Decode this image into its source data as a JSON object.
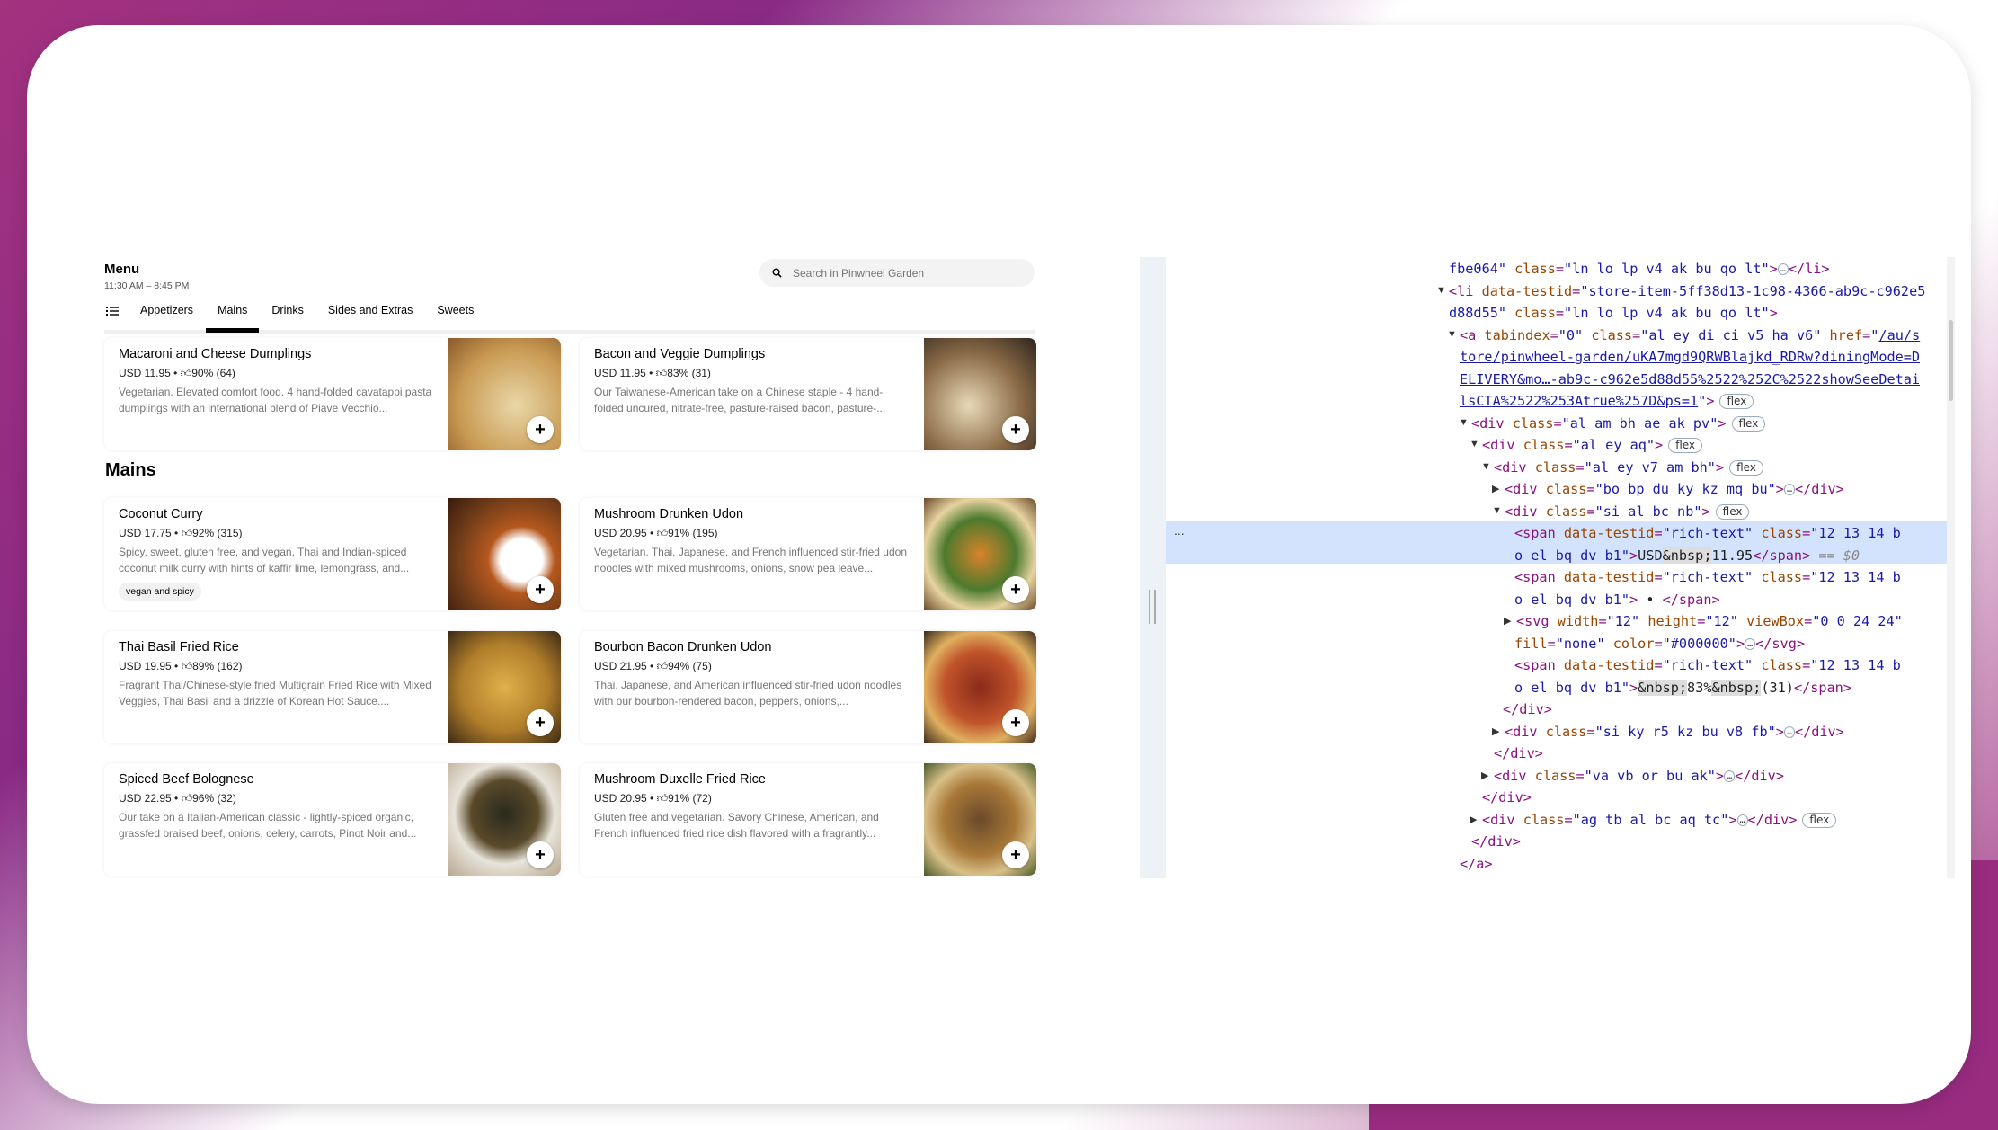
{
  "menu": {
    "title": "Menu",
    "hours": "11:30 AM – 8:45 PM",
    "search_placeholder": "Search in Pinwheel Garden",
    "tabs": [
      {
        "label": "Appetizers"
      },
      {
        "label": "Mains",
        "active": true
      },
      {
        "label": "Drinks"
      },
      {
        "label": "Sides and Extras"
      },
      {
        "label": "Sweets"
      }
    ],
    "section_heading": "Mains",
    "add_label": "+",
    "items": [
      {
        "title": "Macaroni and Cheese Dumplings",
        "price": "USD 11.95 • ",
        "rating": "90% (64)",
        "desc": "Vegetarian. Elevated comfort food. 4 hand-folded cavatappi pasta dumplings with an international blend of Piave Vecchio...",
        "tag": ""
      },
      {
        "title": "Bacon and Veggie Dumplings",
        "price": "USD 11.95 • ",
        "rating": "83% (31)",
        "desc": "Our Taiwanese-American take on a Chinese staple - 4 hand-folded uncured, nitrate-free, pasture-raised bacon, pasture-...",
        "tag": ""
      },
      {
        "title": "Coconut Curry",
        "price": "USD 17.75 • ",
        "rating": "92% (315)",
        "desc": "Spicy, sweet, gluten free, and vegan, Thai and Indian-spiced coconut milk curry with hints of kaffir lime, lemongrass, and...",
        "tag": "vegan and spicy"
      },
      {
        "title": "Mushroom Drunken Udon",
        "price": "USD 20.95 • ",
        "rating": "91% (195)",
        "desc": "Vegetarian. Thai, Japanese, and French influenced stir-fried udon noodles with mixed mushrooms, onions, snow pea leave...",
        "tag": ""
      },
      {
        "title": "Thai Basil Fried Rice",
        "price": "USD 19.95 • ",
        "rating": "89% (162)",
        "desc": "Fragrant Thai/Chinese-style fried Multigrain Fried Rice with Mixed Veggies, Thai Basil and a drizzle of Korean Hot Sauce....",
        "tag": ""
      },
      {
        "title": "Bourbon Bacon Drunken Udon",
        "price": "USD 21.95 • ",
        "rating": "94% (75)",
        "desc": "Thai, Japanese, and American influenced stir-fried udon noodles with our bourbon-rendered bacon, peppers, onions,...",
        "tag": ""
      },
      {
        "title": "Spiced Beef Bolognese",
        "price": "USD 22.95 • ",
        "rating": "96% (32)",
        "desc": "Our take on a Italian-American classic - lightly-spiced organic, grassfed braised beef, onions, celery, carrots, Pinot Noir and...",
        "tag": ""
      },
      {
        "title": "Mushroom Duxelle Fried Rice",
        "price": "USD 20.95 • ",
        "rating": "91% (72)",
        "desc": "Gluten free and vegetarian. Savory Chinese, American, and French influenced fried rice dish flavored with a fragrantly...",
        "tag": ""
      }
    ]
  },
  "devtools": {
    "selected_marker": "...",
    "lines": [
      {
        "arrow": "",
        "segs": [
          [
            "av",
            "fbe064\""
          ],
          [
            "an",
            " class"
          ],
          [
            "tg",
            "="
          ],
          [
            "av",
            "\"ln lo lp v4 ak bu qo lt\""
          ],
          [
            "tg",
            ">"
          ],
          [
            "ell",
            "…"
          ],
          [
            "tg",
            "</li>"
          ]
        ]
      },
      {
        "arrow": "▼",
        "segs": [
          [
            "tg",
            "<li"
          ],
          [
            "an",
            " data-testid"
          ],
          [
            "tg",
            "="
          ],
          [
            "av",
            "\"store-item-5ff38d13-1c98-4366-ab9c-c962e5"
          ]
        ]
      },
      {
        "arrow": "",
        "segs": [
          [
            "av",
            "d88d55\""
          ],
          [
            "an",
            " class"
          ],
          [
            "tg",
            "="
          ],
          [
            "av",
            "\"ln lo lp v4 ak bu qo lt\""
          ],
          [
            "tg",
            ">"
          ]
        ]
      },
      {
        "arrow": "▼",
        "segs": [
          [
            "tg",
            "<a"
          ],
          [
            "an",
            " tabindex"
          ],
          [
            "tg",
            "="
          ],
          [
            "av",
            "\"0\""
          ],
          [
            "an",
            " class"
          ],
          [
            "tg",
            "="
          ],
          [
            "av",
            "\"al ey di ci v5 ha v6\""
          ],
          [
            "an",
            " href"
          ],
          [
            "tg",
            "="
          ],
          [
            "av",
            "\""
          ],
          [
            "lk",
            "/au/s"
          ]
        ]
      },
      {
        "arrow": "",
        "segs": [
          [
            "lk",
            "tore/pinwheel-garden/uKA7mgd9QRWBlajkd_RDRw?diningMode=D"
          ]
        ]
      },
      {
        "arrow": "",
        "segs": [
          [
            "lk",
            "ELIVERY&mo…-ab9c-c962e5d88d55%2522%252C%2522showSeeDetai"
          ]
        ]
      },
      {
        "arrow": "",
        "segs": [
          [
            "lk",
            "lsCTA%2522%253Atrue%257D&ps=1"
          ],
          [
            "av",
            "\""
          ],
          [
            "tg",
            ">"
          ],
          [
            "badge",
            "flex"
          ]
        ]
      },
      {
        "arrow": "▼",
        "segs": [
          [
            "tg",
            "<div"
          ],
          [
            "an",
            " class"
          ],
          [
            "tg",
            "="
          ],
          [
            "av",
            "\"al am bh ae ak pv\""
          ],
          [
            "tg",
            ">"
          ],
          [
            "badge",
            "flex"
          ]
        ]
      },
      {
        "arrow": "▼",
        "segs": [
          [
            "tg",
            "<div"
          ],
          [
            "an",
            " class"
          ],
          [
            "tg",
            "="
          ],
          [
            "av",
            "\"al ey aq\""
          ],
          [
            "tg",
            ">"
          ],
          [
            "badge",
            "flex"
          ]
        ]
      },
      {
        "arrow": "▼",
        "segs": [
          [
            "tg",
            "<div"
          ],
          [
            "an",
            " class"
          ],
          [
            "tg",
            "="
          ],
          [
            "av",
            "\"al ey v7 am bh\""
          ],
          [
            "tg",
            ">"
          ],
          [
            "badge",
            "flex"
          ]
        ]
      },
      {
        "arrow": "▶",
        "segs": [
          [
            "tg",
            "<div"
          ],
          [
            "an",
            " class"
          ],
          [
            "tg",
            "="
          ],
          [
            "av",
            "\"bo bp du ky kz mq bu\""
          ],
          [
            "tg",
            ">"
          ],
          [
            "ell",
            "…"
          ],
          [
            "tg",
            "</div>"
          ]
        ]
      },
      {
        "arrow": "▼",
        "segs": [
          [
            "tg",
            "<div"
          ],
          [
            "an",
            " class"
          ],
          [
            "tg",
            "="
          ],
          [
            "av",
            "\"si al bc nb\""
          ],
          [
            "tg",
            ">"
          ],
          [
            "badge",
            "flex"
          ]
        ]
      },
      {
        "arrow": "",
        "segs": [
          [
            "tg",
            "<span"
          ],
          [
            "an",
            " data-testid"
          ],
          [
            "tg",
            "="
          ],
          [
            "av",
            "\"rich-text\""
          ],
          [
            "an",
            " class"
          ],
          [
            "tg",
            "="
          ],
          [
            "av",
            "\"12 13 14 b"
          ]
        ]
      },
      {
        "arrow": "",
        "segs": [
          [
            "av",
            "o el bq dv b1\""
          ],
          [
            "tg",
            ">"
          ],
          [
            "pl",
            "USD"
          ],
          [
            "nb",
            "&nbsp;"
          ],
          [
            "pl",
            "11.95"
          ],
          [
            "tg",
            "</span>"
          ],
          [
            "cm",
            " == $0"
          ]
        ]
      },
      {
        "arrow": "",
        "segs": [
          [
            "tg",
            "<span"
          ],
          [
            "an",
            " data-testid"
          ],
          [
            "tg",
            "="
          ],
          [
            "av",
            "\"rich-text\""
          ],
          [
            "an",
            " class"
          ],
          [
            "tg",
            "="
          ],
          [
            "av",
            "\"12 13 14 b"
          ]
        ]
      },
      {
        "arrow": "",
        "segs": [
          [
            "av",
            "o el bq dv b1\""
          ],
          [
            "tg",
            ">"
          ],
          [
            "pl",
            " • "
          ],
          [
            "tg",
            "</span>"
          ]
        ]
      },
      {
        "arrow": "▶",
        "segs": [
          [
            "tg",
            "<svg"
          ],
          [
            "an",
            " width"
          ],
          [
            "tg",
            "="
          ],
          [
            "av",
            "\"12\""
          ],
          [
            "an",
            " height"
          ],
          [
            "tg",
            "="
          ],
          [
            "av",
            "\"12\""
          ],
          [
            "an",
            " viewBox"
          ],
          [
            "tg",
            "="
          ],
          [
            "av",
            "\"0 0 24 24\""
          ]
        ]
      },
      {
        "arrow": "",
        "segs": [
          [
            "an",
            "fill"
          ],
          [
            "tg",
            "="
          ],
          [
            "av",
            "\"none\""
          ],
          [
            "an",
            " color"
          ],
          [
            "tg",
            "="
          ],
          [
            "av",
            "\"#000000\""
          ],
          [
            "tg",
            ">"
          ],
          [
            "ell",
            "…"
          ],
          [
            "tg",
            "</svg>"
          ]
        ]
      },
      {
        "arrow": "",
        "segs": [
          [
            "tg",
            "<span"
          ],
          [
            "an",
            " data-testid"
          ],
          [
            "tg",
            "="
          ],
          [
            "av",
            "\"rich-text\""
          ],
          [
            "an",
            " class"
          ],
          [
            "tg",
            "="
          ],
          [
            "av",
            "\"12 13 14 b"
          ]
        ]
      },
      {
        "arrow": "",
        "segs": [
          [
            "av",
            "o el bq dv b1\""
          ],
          [
            "tg",
            ">"
          ],
          [
            "nb",
            "&nbsp;"
          ],
          [
            "pl",
            "83%"
          ],
          [
            "nb",
            "&nbsp;"
          ],
          [
            "pl",
            "(31)"
          ],
          [
            "tg",
            "</span>"
          ]
        ]
      },
      {
        "arrow": "",
        "segs": [
          [
            "tg",
            "</div>"
          ]
        ]
      },
      {
        "arrow": "▶",
        "segs": [
          [
            "tg",
            "<div"
          ],
          [
            "an",
            " class"
          ],
          [
            "tg",
            "="
          ],
          [
            "av",
            "\"si ky r5 kz bu v8 fb\""
          ],
          [
            "tg",
            ">"
          ],
          [
            "ell",
            "…"
          ],
          [
            "tg",
            "</div>"
          ]
        ]
      },
      {
        "arrow": "",
        "segs": [
          [
            "tg",
            "</div>"
          ]
        ]
      },
      {
        "arrow": "▶",
        "segs": [
          [
            "tg",
            "<div"
          ],
          [
            "an",
            " class"
          ],
          [
            "tg",
            "="
          ],
          [
            "av",
            "\"va vb or bu ak\""
          ],
          [
            "tg",
            ">"
          ],
          [
            "ell",
            "…"
          ],
          [
            "tg",
            "</div>"
          ]
        ]
      },
      {
        "arrow": "",
        "segs": [
          [
            "tg",
            "</div>"
          ]
        ]
      },
      {
        "arrow": "▶",
        "segs": [
          [
            "tg",
            "<div"
          ],
          [
            "an",
            " class"
          ],
          [
            "tg",
            "="
          ],
          [
            "av",
            "\"ag tb al bc aq tc\""
          ],
          [
            "tg",
            ">"
          ],
          [
            "ell",
            "…"
          ],
          [
            "tg",
            "</div>"
          ],
          [
            "badge",
            "flex"
          ]
        ]
      },
      {
        "arrow": "",
        "segs": [
          [
            "tg",
            "</div>"
          ]
        ]
      },
      {
        "arrow": "",
        "segs": [
          [
            "tg",
            "</a>"
          ]
        ]
      }
    ]
  },
  "colors": {
    "accent": "#000000",
    "brand_bg": "#a3327f",
    "devtools_highlight": "#d3e3fd"
  }
}
